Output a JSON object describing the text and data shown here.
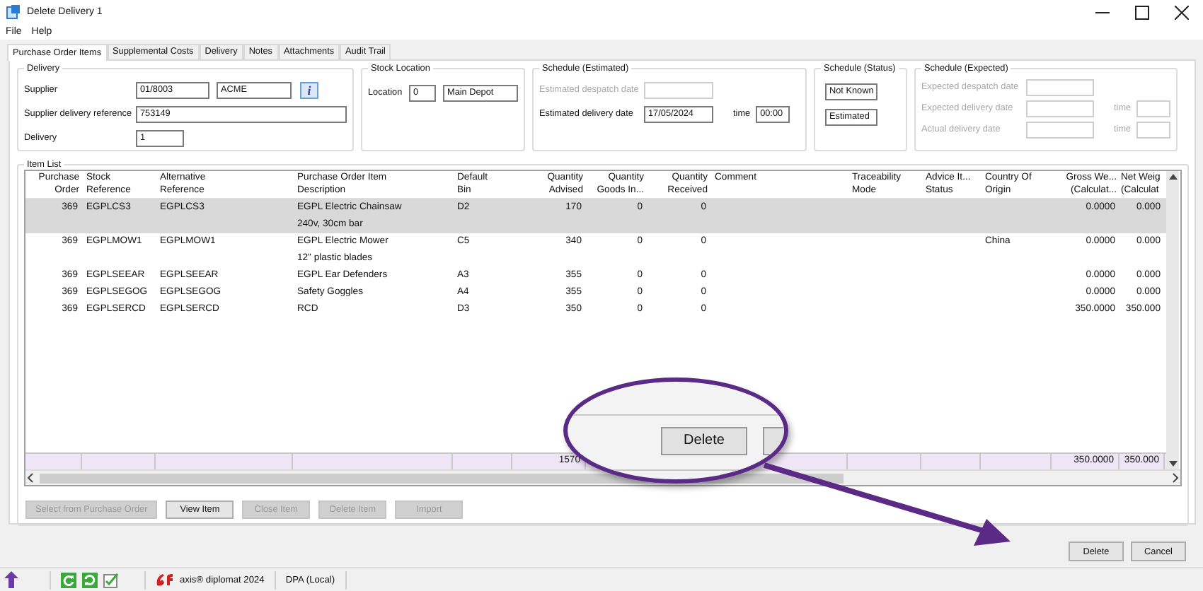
{
  "window": {
    "title": "Delete Delivery 1"
  },
  "menu": [
    "File",
    "Help"
  ],
  "tabs": [
    {
      "label": "Purchase Order Items",
      "selected": true
    },
    {
      "label": "Supplemental Costs",
      "selected": false
    },
    {
      "label": "Delivery",
      "selected": false
    },
    {
      "label": "Notes",
      "selected": false
    },
    {
      "label": "Attachments",
      "selected": false
    },
    {
      "label": "Audit Trail",
      "selected": false
    }
  ],
  "delivery": {
    "title": "Delivery",
    "supplier_label": "Supplier",
    "supplier_code": "01/8003",
    "supplier_name": "ACME",
    "info_button": "i",
    "reference_label": "Supplier delivery reference",
    "reference": "753149",
    "delivery_label": "Delivery",
    "delivery": "1"
  },
  "stock_location": {
    "title": "Stock Location",
    "location_label": "Location",
    "location_code": "0",
    "location_name": "Main Depot"
  },
  "schedule_estimated": {
    "title": "Schedule (Estimated)",
    "fields": [
      {
        "label": "Estimated despatch date",
        "disabled": true
      },
      {
        "label": "Estimated delivery date",
        "value": "17/05/2024",
        "disabled": false,
        "time_label": "time",
        "time": "00:00"
      }
    ]
  },
  "schedule_status": {
    "title": "Schedule (Status)",
    "values": [
      "Not Known",
      "Estimated"
    ]
  },
  "schedule_expected": {
    "title": "Schedule (Expected)",
    "fields": [
      {
        "label": "Expected despatch date",
        "disabled": true
      },
      {
        "label": "Expected delivery date",
        "disabled": true,
        "time_label": "time"
      },
      {
        "label": "Actual delivery date",
        "disabled": true,
        "time_label": "time"
      }
    ]
  },
  "item_list": {
    "title": "Item List",
    "columns": [
      "Purchase\nOrder",
      "Stock\nReference",
      "Alternative\nReference",
      "Purchase Order Item\nDescription",
      "Default\nBin",
      "Quantity\nAdvised",
      "Quantity\nGoods In...",
      "Quantity\nReceived",
      "Comment",
      "Traceability\nMode",
      "Advice It...\nStatus",
      "Country Of\nOrigin",
      "Gross We...\n(Calculat...",
      "Net Weig\n(Calculat"
    ],
    "rows": [
      {
        "selected": true,
        "po": "369",
        "stock": "EGPLCS3",
        "alt": "EGPLCS3",
        "description": "EGPL Electric Chainsaw",
        "note": "240v, 30cm bar",
        "bin": "D2",
        "advised": "170",
        "goods_in": "0",
        "received": "0",
        "gross": "0.0000",
        "net": "0.000"
      },
      {
        "selected": false,
        "po": "369",
        "stock": "EGPLMOW1",
        "alt": "EGPLMOW1",
        "description": "EGPL Electric Mower",
        "note": "12\" plastic blades",
        "bin": "C5",
        "advised": "340",
        "goods_in": "0",
        "received": "0",
        "country": "China",
        "gross": "0.0000",
        "net": "0.000"
      },
      {
        "selected": false,
        "po": "369",
        "stock": "EGPLSEEAR",
        "alt": "EGPLSEEAR",
        "description": "EGPL Ear Defenders",
        "bin": "A3",
        "advised": "355",
        "goods_in": "0",
        "received": "0",
        "gross": "0.0000",
        "net": "0.000"
      },
      {
        "selected": false,
        "po": "369",
        "stock": "EGPLSEGOG",
        "alt": "EGPLSEGOG",
        "description": "Safety Goggles",
        "bin": "A4",
        "advised": "355",
        "goods_in": "0",
        "received": "0",
        "gross": "0.0000",
        "net": "0.000"
      },
      {
        "selected": false,
        "po": "369",
        "stock": "EGPLSERCD",
        "alt": "EGPLSERCD",
        "description": "RCD",
        "bin": "D3",
        "advised": "350",
        "goods_in": "0",
        "received": "0",
        "gross": "350.0000",
        "net": "350.000"
      }
    ],
    "totals": {
      "advised": "1570",
      "gross": "350.0000",
      "net": "350.000"
    }
  },
  "item_buttons": [
    {
      "label": "Select from Purchase Order",
      "disabled": true
    },
    {
      "label": "View Item",
      "disabled": false
    },
    {
      "label": "Close Item",
      "disabled": true
    },
    {
      "label": "Delete Item",
      "disabled": true
    },
    {
      "label": "Import",
      "disabled": true
    }
  ],
  "callout": {
    "button": "Delete"
  },
  "dialog_buttons": [
    "Delete",
    "Cancel"
  ],
  "status_bar": {
    "product": "axis® diplomat 2024",
    "connection": "DPA (Local)"
  }
}
